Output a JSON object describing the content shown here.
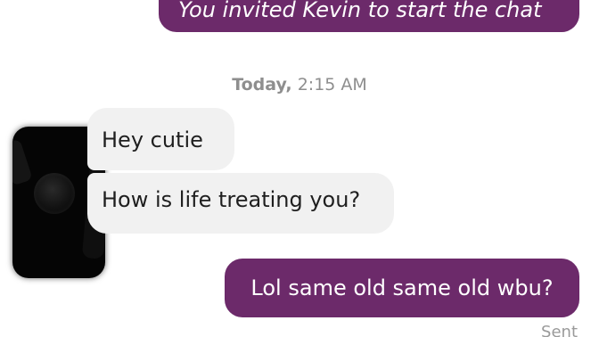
{
  "theme": {
    "accent": "#6c2a6a",
    "incoming": "#f1f1f1"
  },
  "conversation": {
    "messages": [
      {
        "direction": "outgoing",
        "text": "You invited Kevin to start the chat"
      },
      {
        "direction": "incoming",
        "text": "Hey cutie"
      },
      {
        "direction": "incoming",
        "text": "How is life treating you?"
      },
      {
        "direction": "outgoing",
        "text": "Lol same old same old wbu?"
      }
    ],
    "timestamp": {
      "day": "Today,",
      "time": "2:15 AM"
    },
    "status": "Sent",
    "avatar": {
      "icon": "profile-photo-redacted"
    }
  }
}
